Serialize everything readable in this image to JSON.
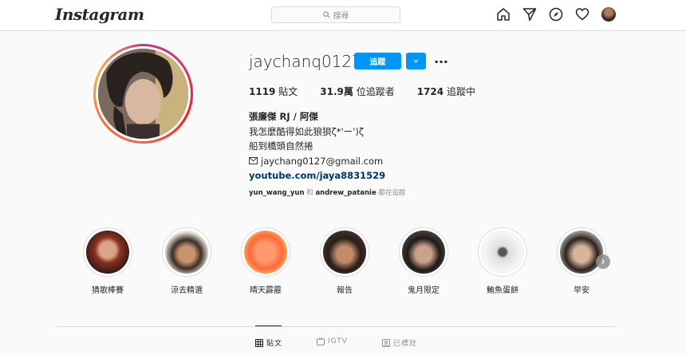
{
  "topbar": {
    "logo": "Instagram",
    "search_placeholder": "搜尋",
    "icons": [
      "home-icon",
      "direct-message-icon",
      "explore-compass-icon",
      "activity-heart-icon",
      "profile-avatar"
    ]
  },
  "profile": {
    "username": "jaychanq0127",
    "follow_label": "追蹤",
    "stats": {
      "posts_count": "1119",
      "posts_label": "貼文",
      "followers_count": "31.9萬",
      "followers_label": "位追蹤者",
      "following_count": "1724",
      "following_label": "追蹤中"
    },
    "bio": {
      "name": "張廉傑 RJ / 阿傑",
      "line1": "我怎麼酷得如此狼狽ζ*'ー')ζ",
      "line2": "船到橋頭自然捲",
      "email": "jaychang0127@gmail.com",
      "link": "youtube.com/jaya8831529"
    },
    "followed_by": {
      "user1": "yun_wang_yun",
      "conj": "和",
      "user2": "andrew_patanie",
      "suffix": "都在追蹤"
    }
  },
  "highlights": [
    {
      "label": "猜歌棒賽"
    },
    {
      "label": "涼去精選"
    },
    {
      "label": "晴天霹靂"
    },
    {
      "label": "報告"
    },
    {
      "label": "鬼月限定"
    },
    {
      "label": "鮪魚蛋餅"
    },
    {
      "label": "早安"
    }
  ],
  "tabs": [
    {
      "label": "貼文",
      "icon": "grid-icon",
      "active": true
    },
    {
      "label": "IGTV",
      "icon": "igtv-icon",
      "active": false
    },
    {
      "label": "已標註",
      "icon": "tagged-icon",
      "active": false
    }
  ],
  "colors": {
    "accent": "#0095f6",
    "link": "#00376b",
    "border": "#dbdbdb",
    "muted": "#8e8e8e"
  }
}
